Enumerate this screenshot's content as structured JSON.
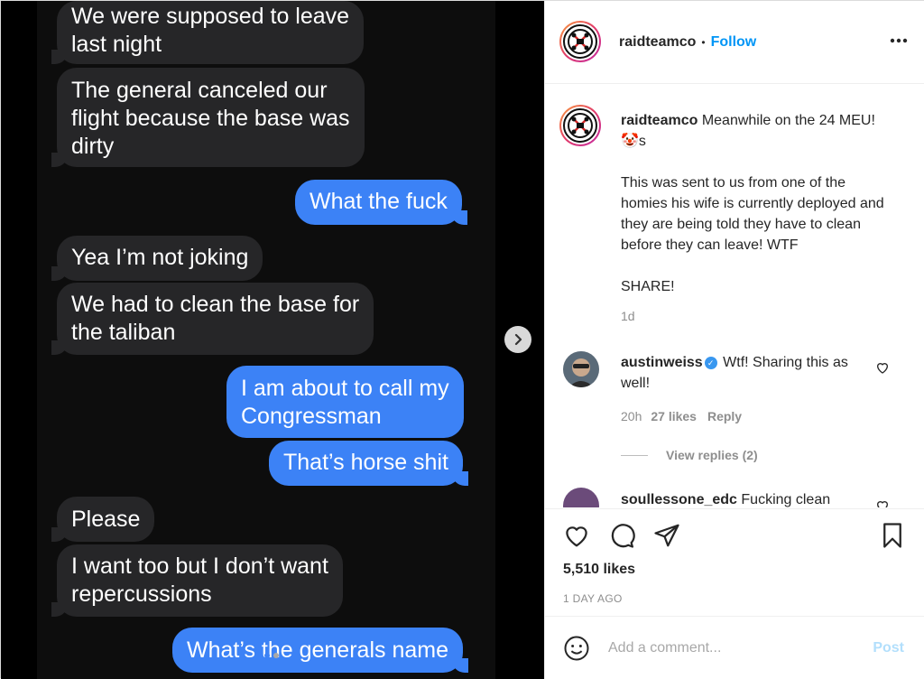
{
  "messages": [
    {
      "dir": "in",
      "text": "We were supposed to leave\nlast night"
    },
    {
      "dir": "in",
      "text": "The general canceled our\nflight because the base was\ndirty"
    },
    {
      "dir": "out",
      "text": "What the fuck"
    },
    {
      "dir": "in",
      "text": "Yea I’m not joking"
    },
    {
      "dir": "in",
      "text": "We had to clean the base for\nthe taliban"
    },
    {
      "dir": "out",
      "text": "I am about to call my\nCongressman"
    },
    {
      "dir": "out",
      "text": "That’s horse shit"
    },
    {
      "dir": "in",
      "text": "Please"
    },
    {
      "dir": "in",
      "text": "I want too but I don’t want\nrepercussions"
    },
    {
      "dir": "out",
      "text": "What’s the generals name"
    }
  ],
  "header": {
    "username": "raidteamco",
    "separator": "•",
    "follow": "Follow",
    "more_icon": "more-horizontal-icon"
  },
  "caption": {
    "username": "raidteamco",
    "text": "Meanwhile on the 24 MEU! 🤡s\n\nThis was sent to us from one of the homies his wife is currently deployed and they are being told they have to clean before they can leave! WTF\n\nSHARE!",
    "time": "1d"
  },
  "comments": [
    {
      "username": "austinweiss",
      "verified": true,
      "text": "Wtf! Sharing this as well!",
      "time": "20h",
      "likes": "27 likes",
      "reply": "Reply",
      "view_replies": "View replies (2)"
    },
    {
      "username": "soullessone_edc",
      "text": "Fucking clean"
    }
  ],
  "actions": {
    "likes": "5,510 likes",
    "date": "1 DAY AGO"
  },
  "add_comment": {
    "placeholder": "Add a comment...",
    "post": "Post"
  },
  "colors": {
    "accent": "#0095f6",
    "imessage_blue": "#3c82f6",
    "imessage_gray": "#262628"
  }
}
